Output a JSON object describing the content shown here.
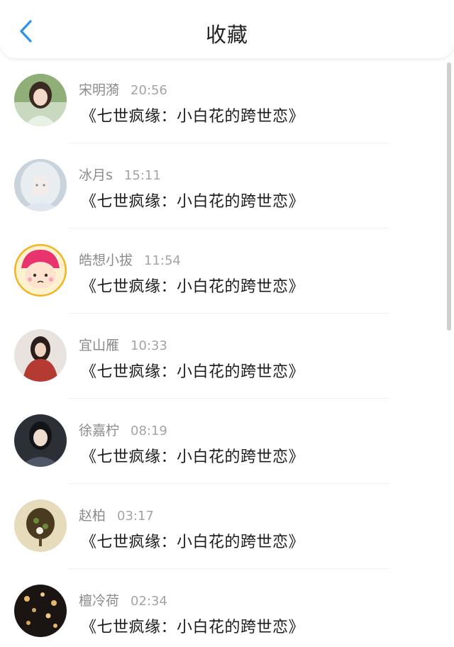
{
  "header": {
    "title": "收藏",
    "back_icon": "chevron-left-icon",
    "accent_color": "#2c93e8"
  },
  "favorites": [
    {
      "user": "宋明漪",
      "time": "20:56",
      "content": "《七世疯缘：小白花的跨世恋》",
      "avatar": "avatar-girl-green"
    },
    {
      "user": "冰月s",
      "time": "15:11",
      "content": "《七世疯缘：小白花的跨世恋》",
      "avatar": "avatar-silver-hair"
    },
    {
      "user": "皓想小拔",
      "time": "11:54",
      "content": "《七世疯缘：小白花的跨世恋》",
      "avatar": "avatar-cartoon-pink"
    },
    {
      "user": "宜山雁",
      "time": "10:33",
      "content": "《七世疯缘：小白花的跨世恋》",
      "avatar": "avatar-red-dress"
    },
    {
      "user": "徐嘉柠",
      "time": "08:19",
      "content": "《七世疯缘：小白花的跨世恋》",
      "avatar": "avatar-dark-portrait"
    },
    {
      "user": "赵柏",
      "time": "03:17",
      "content": "《七世疯缘：小白花的跨世恋》",
      "avatar": "avatar-tree-drawing"
    },
    {
      "user": "檀冷荷",
      "time": "02:34",
      "content": "《七世疯缘：小白花的跨世恋》",
      "avatar": "avatar-night-lights"
    }
  ]
}
